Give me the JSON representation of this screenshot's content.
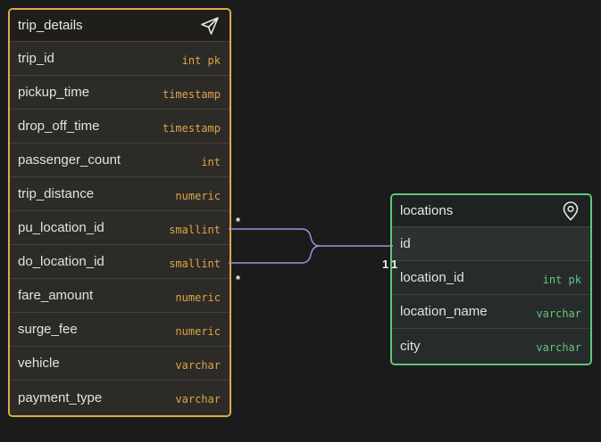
{
  "tables": {
    "trip_details": {
      "name": "trip_details",
      "icon": "send-icon",
      "accent": "#e0a948",
      "columns": [
        {
          "name": "trip_id",
          "type": "int pk"
        },
        {
          "name": "pickup_time",
          "type": "timestamp"
        },
        {
          "name": "drop_off_time",
          "type": "timestamp"
        },
        {
          "name": "passenger_count",
          "type": "int"
        },
        {
          "name": "trip_distance",
          "type": "numeric"
        },
        {
          "name": "pu_location_id",
          "type": "smallint"
        },
        {
          "name": "do_location_id",
          "type": "smallint"
        },
        {
          "name": "fare_amount",
          "type": "numeric"
        },
        {
          "name": "surge_fee",
          "type": "numeric"
        },
        {
          "name": "vehicle",
          "type": "varchar"
        },
        {
          "name": "payment_type",
          "type": "varchar"
        }
      ]
    },
    "locations": {
      "name": "locations",
      "icon": "map-pin-icon",
      "accent": "#5fc87a",
      "columns": [
        {
          "name": "id",
          "type": ""
        },
        {
          "name": "location_id",
          "type": "int pk"
        },
        {
          "name": "location_name",
          "type": "varchar"
        },
        {
          "name": "city",
          "type": "varchar"
        }
      ]
    }
  },
  "relationships": [
    {
      "from": "trip_details.pu_location_id",
      "to": "locations.id",
      "from_card": "*",
      "to_card": "1"
    },
    {
      "from": "trip_details.do_location_id",
      "to": "locations.id",
      "from_card": "*",
      "to_card": "1"
    }
  ],
  "relationship_color": "#9b94d6"
}
